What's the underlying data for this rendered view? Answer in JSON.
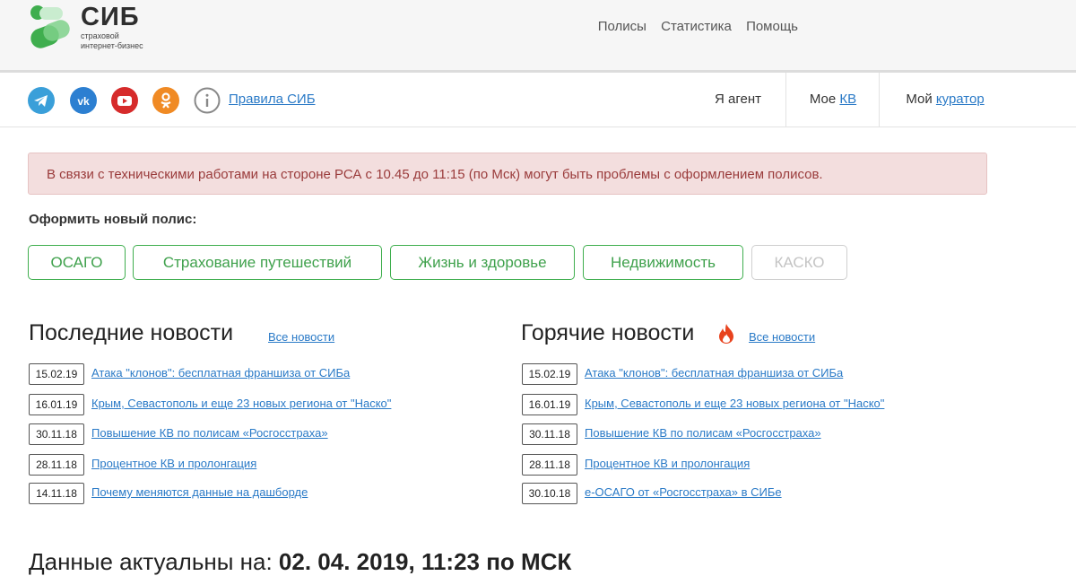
{
  "logo": {
    "name": "СИБ",
    "sub_line1": "страховой",
    "sub_line2": "интернет-бизнес"
  },
  "topnav": [
    "Полисы",
    "Статистика",
    "Помощь"
  ],
  "subbar": {
    "social_icons": [
      "telegram-icon",
      "vk-icon",
      "youtube-icon",
      "odnoklassniki-icon",
      "info-icon"
    ],
    "rules_link": "Правила СИБ",
    "agent": "Я агент",
    "my_kv_prefix": "Мое",
    "my_kv_link": "КВ",
    "my_curator_prefix": "Мой",
    "my_curator_link": "куратор"
  },
  "alert": "В связи с техническими работами на стороне РСА с 10.45 до 11:15 (по Мск) могут быть проблемы с оформлением полисов.",
  "new_policy": {
    "label": "Оформить новый полис:",
    "buttons": [
      {
        "label": "ОСАГО"
      },
      {
        "label": "Страхование путешествий"
      },
      {
        "label": "Жизнь и здоровье"
      },
      {
        "label": "Недвижимость"
      },
      {
        "label": "КАСКО"
      }
    ]
  },
  "latest_news": {
    "title": "Последние новости",
    "all_link": "Все новости",
    "items": [
      {
        "date": "15.02.19",
        "text": "Атака \"клонов\": бесплатная франшиза от СИБа"
      },
      {
        "date": "16.01.19",
        "text": "Крым, Севастополь и еще 23 новых региона от \"Наско\""
      },
      {
        "date": "30.11.18",
        "text": "Повышение КВ по полисам «Росгосстраха»"
      },
      {
        "date": "28.11.18",
        "text": "Процентное КВ и пролонгация"
      },
      {
        "date": "14.11.18",
        "text": "Почему меняются данные на дашборде"
      }
    ]
  },
  "hot_news": {
    "title": "Горячие новости",
    "all_link": "Все новости",
    "items": [
      {
        "date": "15.02.19",
        "text": "Атака \"клонов\": бесплатная франшиза от СИБа"
      },
      {
        "date": "16.01.19",
        "text": "Крым, Севастополь и еще 23 новых региона от \"Наско\""
      },
      {
        "date": "30.11.18",
        "text": "Повышение КВ по полисам «Росгосстраха»"
      },
      {
        "date": "28.11.18",
        "text": "Процентное КВ и пролонгация"
      },
      {
        "date": "30.10.18",
        "text": "е-ОСАГО от «Росгосстраха» в СИБе"
      }
    ]
  },
  "updated": {
    "prefix": "Данные актуальны на:",
    "value": "02. 04. 2019, 11:23 по МСК"
  },
  "colors": {
    "green": "#3fae4e",
    "link": "#2a7ac7",
    "alert_bg": "#f3dede",
    "alert_text": "#9a3b3b"
  }
}
